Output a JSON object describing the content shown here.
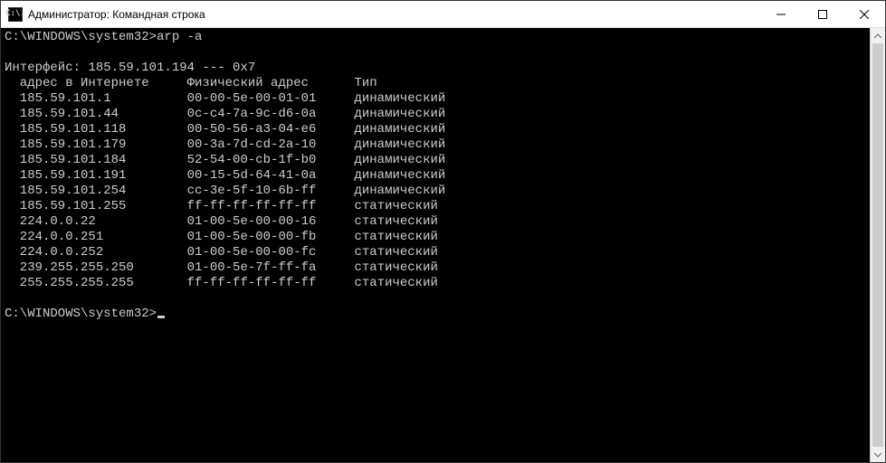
{
  "window": {
    "title": "Администратор: Командная строка",
    "icon_text": "C:\\."
  },
  "terminal": {
    "prompt1_path": "C:\\WINDOWS\\system32>",
    "prompt1_cmd": "arp -a",
    "blank1": "",
    "interface_line": "Интерфейс: 185.59.101.194 --- 0x7",
    "header": {
      "col1": "  адрес в Интернете",
      "col2": "Физический адрес",
      "col3": "Тип"
    },
    "rows": [
      {
        "ip": "185.59.101.1",
        "mac": "00-00-5e-00-01-01",
        "type": "динамический"
      },
      {
        "ip": "185.59.101.44",
        "mac": "0c-c4-7a-9c-d6-0a",
        "type": "динамический"
      },
      {
        "ip": "185.59.101.118",
        "mac": "00-50-56-a3-04-e6",
        "type": "динамический"
      },
      {
        "ip": "185.59.101.179",
        "mac": "00-3a-7d-cd-2a-10",
        "type": "динамический"
      },
      {
        "ip": "185.59.101.184",
        "mac": "52-54-00-cb-1f-b0",
        "type": "динамический"
      },
      {
        "ip": "185.59.101.191",
        "mac": "00-15-5d-64-41-0a",
        "type": "динамический"
      },
      {
        "ip": "185.59.101.254",
        "mac": "cc-3e-5f-10-6b-ff",
        "type": "динамический"
      },
      {
        "ip": "185.59.101.255",
        "mac": "ff-ff-ff-ff-ff-ff",
        "type": "статический"
      },
      {
        "ip": "224.0.0.22",
        "mac": "01-00-5e-00-00-16",
        "type": "статический"
      },
      {
        "ip": "224.0.0.251",
        "mac": "01-00-5e-00-00-fb",
        "type": "статический"
      },
      {
        "ip": "224.0.0.252",
        "mac": "01-00-5e-00-00-fc",
        "type": "статический"
      },
      {
        "ip": "239.255.255.250",
        "mac": "01-00-5e-7f-ff-fa",
        "type": "статический"
      },
      {
        "ip": "255.255.255.255",
        "mac": "ff-ff-ff-ff-ff-ff",
        "type": "статический"
      }
    ],
    "blank2": "",
    "prompt2_path": "C:\\WINDOWS\\system32>"
  }
}
